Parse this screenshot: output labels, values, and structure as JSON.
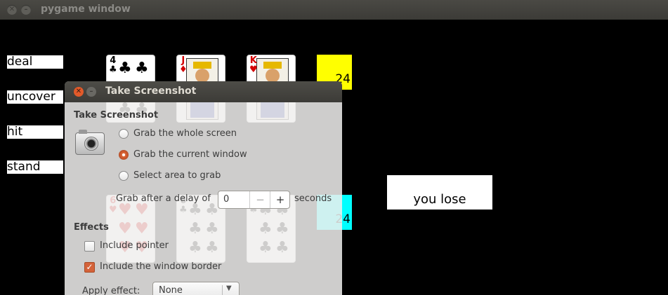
{
  "window": {
    "title": "pygame window",
    "close_glyph": "✕",
    "minimize_glyph": "–"
  },
  "game": {
    "buttons": [
      "deal",
      "uncover",
      "hit",
      "stand"
    ],
    "top_cards": [
      {
        "rank": "4",
        "suit": "♣",
        "color": "#000000"
      },
      {
        "rank": "J",
        "suit": "♦",
        "color": "#d40000"
      },
      {
        "rank": "K",
        "suit": "♥",
        "color": "#d40000"
      }
    ],
    "bottom_cards": [
      {
        "rank": "6",
        "suit": "♥",
        "color": "#d40000"
      },
      {
        "rank": "6",
        "suit": "♣",
        "color": "#000000"
      },
      {
        "rank": "6",
        "suit": "♣",
        "color": "#000000"
      }
    ],
    "dealer_score": "24",
    "player_score": "24",
    "dealer_score_color": "#ffff00",
    "player_score_color": "#00ffff",
    "result": "you lose"
  },
  "dialog": {
    "title": "Take Screenshot",
    "section_title": "Take Screenshot",
    "icon": "camera-icon",
    "options": [
      {
        "label": "Grab the whole screen",
        "selected": false
      },
      {
        "label": "Grab the current window",
        "selected": true
      },
      {
        "label": "Select area to grab",
        "selected": false
      }
    ],
    "delay_label": "Grab after a delay of",
    "delay_value": "0",
    "delay_unit": "seconds",
    "minus": "−",
    "plus": "+",
    "effects_title": "Effects",
    "include_pointer": {
      "label": "Include pointer",
      "checked": false
    },
    "include_border": {
      "label": "Include the window border",
      "checked": true
    },
    "apply_effect_label": "Apply effect:",
    "apply_effect_value": "None",
    "accent": "#dd4814"
  }
}
